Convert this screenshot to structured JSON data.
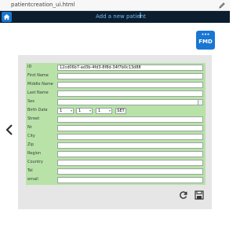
{
  "window": {
    "title": "patientcreation_ui.html"
  },
  "navbar": {
    "title": "Add a new patient",
    "info_icon": "info-icon",
    "home_icon": "home-icon"
  },
  "logo": {
    "text": "FMD"
  },
  "form": {
    "fields": [
      {
        "label": "ID",
        "value": "12cd06b7-ad3b-4fd3-8f8d-34f7b0c13d88"
      },
      {
        "label": "First Name",
        "value": ""
      },
      {
        "label": "Middle Name",
        "value": ""
      },
      {
        "label": "Last Name",
        "value": ""
      },
      {
        "label": "Sex",
        "value": ""
      },
      {
        "label": "Birth Date",
        "day": "1",
        "month": "1",
        "year": "1",
        "set_label": "SET"
      },
      {
        "label": "Street",
        "value": ""
      },
      {
        "label": "Nr",
        "value": ""
      },
      {
        "label": "City",
        "value": ""
      },
      {
        "label": "Zip",
        "value": ""
      },
      {
        "label": "Region",
        "value": ""
      },
      {
        "label": "Country",
        "value": ""
      },
      {
        "label": "Tel",
        "value": ""
      },
      {
        "label": "email",
        "value": ""
      }
    ]
  },
  "icons": {
    "prev": "chevron-left-icon",
    "refresh": "refresh-icon",
    "save": "save-icon",
    "edit": "edit-icon"
  },
  "colors": {
    "navbar": "#0b1d2e",
    "accent": "#1976d2",
    "form_bg": "#b8e2a8",
    "panel_bg": "#e6e6e6"
  }
}
